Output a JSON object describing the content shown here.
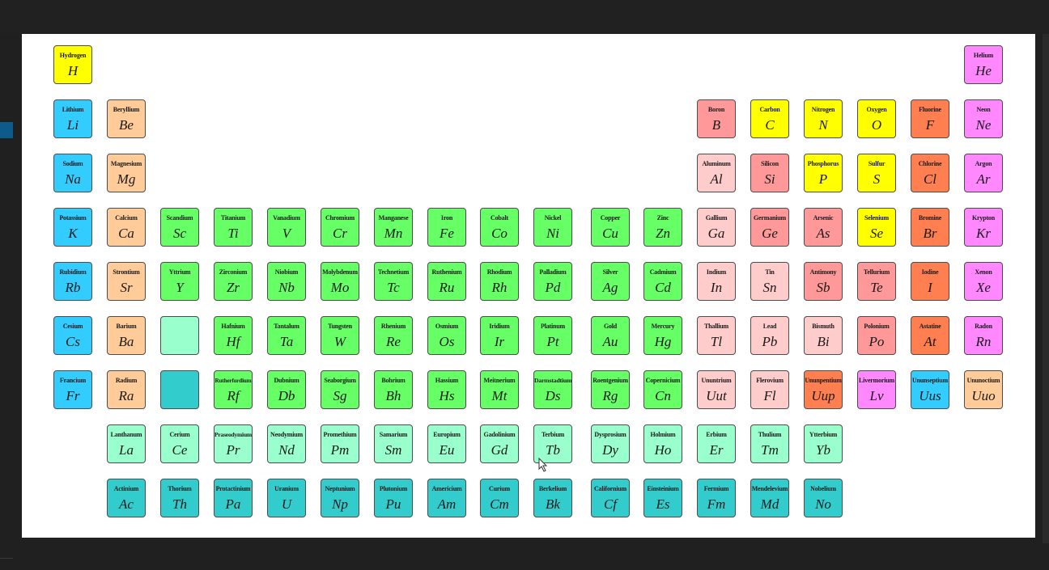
{
  "colors": {
    "alkali": "#33ccff",
    "alkaline_earth": "#ffcc99",
    "transition": "#66ff66",
    "post_transition": "#ffcccc",
    "metalloid": "#ff9999",
    "nonmetal": "#ffff00",
    "halogen": "#ff7f50",
    "noble_gas": "#ff88ff",
    "lanthanide": "#99ffcc",
    "actinide": "#33cccc",
    "page_background": "#202020",
    "panel_background": "#ffffff"
  },
  "elements": [
    {
      "name": "Hydrogen",
      "symbol": "H",
      "category": "nonmetal",
      "row": 1,
      "col": 1
    },
    {
      "name": "Helium",
      "symbol": "He",
      "category": "noble_gas",
      "row": 1,
      "col": 18
    },
    {
      "name": "Lithium",
      "symbol": "Li",
      "category": "alkali",
      "row": 2,
      "col": 1
    },
    {
      "name": "Beryllium",
      "symbol": "Be",
      "category": "alkaline_earth",
      "row": 2,
      "col": 2
    },
    {
      "name": "Boron",
      "symbol": "B",
      "category": "metalloid",
      "row": 2,
      "col": 13
    },
    {
      "name": "Carbon",
      "symbol": "C",
      "category": "nonmetal",
      "row": 2,
      "col": 14
    },
    {
      "name": "Nitrogen",
      "symbol": "N",
      "category": "nonmetal",
      "row": 2,
      "col": 15
    },
    {
      "name": "Oxygen",
      "symbol": "O",
      "category": "nonmetal",
      "row": 2,
      "col": 16
    },
    {
      "name": "Fluorine",
      "symbol": "F",
      "category": "halogen",
      "row": 2,
      "col": 17
    },
    {
      "name": "Neon",
      "symbol": "Ne",
      "category": "noble_gas",
      "row": 2,
      "col": 18
    },
    {
      "name": "Sodium",
      "symbol": "Na",
      "category": "alkali",
      "row": 3,
      "col": 1
    },
    {
      "name": "Magnesium",
      "symbol": "Mg",
      "category": "alkaline_earth",
      "row": 3,
      "col": 2
    },
    {
      "name": "Aluminum",
      "symbol": "Al",
      "category": "post_transition",
      "row": 3,
      "col": 13
    },
    {
      "name": "Silicon",
      "symbol": "Si",
      "category": "metalloid",
      "row": 3,
      "col": 14
    },
    {
      "name": "Phosphorus",
      "symbol": "P",
      "category": "nonmetal",
      "row": 3,
      "col": 15
    },
    {
      "name": "Sulfur",
      "symbol": "S",
      "category": "nonmetal",
      "row": 3,
      "col": 16
    },
    {
      "name": "Chlorine",
      "symbol": "Cl",
      "category": "halogen",
      "row": 3,
      "col": 17
    },
    {
      "name": "Argon",
      "symbol": "Ar",
      "category": "noble_gas",
      "row": 3,
      "col": 18
    },
    {
      "name": "Potassium",
      "symbol": "K",
      "category": "alkali",
      "row": 4,
      "col": 1
    },
    {
      "name": "Calcium",
      "symbol": "Ca",
      "category": "alkaline_earth",
      "row": 4,
      "col": 2
    },
    {
      "name": "Scandium",
      "symbol": "Sc",
      "category": "transition",
      "row": 4,
      "col": 3
    },
    {
      "name": "Titanium",
      "symbol": "Ti",
      "category": "transition",
      "row": 4,
      "col": 4
    },
    {
      "name": "Vanadium",
      "symbol": "V",
      "category": "transition",
      "row": 4,
      "col": 5
    },
    {
      "name": "Chromium",
      "symbol": "Cr",
      "category": "transition",
      "row": 4,
      "col": 6
    },
    {
      "name": "Manganese",
      "symbol": "Mn",
      "category": "transition",
      "row": 4,
      "col": 7
    },
    {
      "name": "Iron",
      "symbol": "Fe",
      "category": "transition",
      "row": 4,
      "col": 8
    },
    {
      "name": "Cobalt",
      "symbol": "Co",
      "category": "transition",
      "row": 4,
      "col": 9
    },
    {
      "name": "Nickel",
      "symbol": "Ni",
      "category": "transition",
      "row": 4,
      "col": 10
    },
    {
      "name": "Copper",
      "symbol": "Cu",
      "category": "transition",
      "row": 4,
      "col": 11
    },
    {
      "name": "Zinc",
      "symbol": "Zn",
      "category": "transition",
      "row": 4,
      "col": 12
    },
    {
      "name": "Gallium",
      "symbol": "Ga",
      "category": "post_transition",
      "row": 4,
      "col": 13
    },
    {
      "name": "Germanium",
      "symbol": "Ge",
      "category": "metalloid",
      "row": 4,
      "col": 14
    },
    {
      "name": "Arsenic",
      "symbol": "As",
      "category": "metalloid",
      "row": 4,
      "col": 15
    },
    {
      "name": "Selenium",
      "symbol": "Se",
      "category": "nonmetal",
      "row": 4,
      "col": 16
    },
    {
      "name": "Bromine",
      "symbol": "Br",
      "category": "halogen",
      "row": 4,
      "col": 17
    },
    {
      "name": "Krypton",
      "symbol": "Kr",
      "category": "noble_gas",
      "row": 4,
      "col": 18
    },
    {
      "name": "Rubidium",
      "symbol": "Rb",
      "category": "alkali",
      "row": 5,
      "col": 1
    },
    {
      "name": "Strontium",
      "symbol": "Sr",
      "category": "alkaline_earth",
      "row": 5,
      "col": 2
    },
    {
      "name": "Yttrium",
      "symbol": "Y",
      "category": "transition",
      "row": 5,
      "col": 3
    },
    {
      "name": "Zirconium",
      "symbol": "Zr",
      "category": "transition",
      "row": 5,
      "col": 4
    },
    {
      "name": "Niobium",
      "symbol": "Nb",
      "category": "transition",
      "row": 5,
      "col": 5
    },
    {
      "name": "Molybdenum",
      "symbol": "Mo",
      "category": "transition",
      "row": 5,
      "col": 6
    },
    {
      "name": "Technetium",
      "symbol": "Tc",
      "category": "transition",
      "row": 5,
      "col": 7
    },
    {
      "name": "Ruthenium",
      "symbol": "Ru",
      "category": "transition",
      "row": 5,
      "col": 8
    },
    {
      "name": "Rhodium",
      "symbol": "Rh",
      "category": "transition",
      "row": 5,
      "col": 9
    },
    {
      "name": "Palladium",
      "symbol": "Pd",
      "category": "transition",
      "row": 5,
      "col": 10
    },
    {
      "name": "Silver",
      "symbol": "Ag",
      "category": "transition",
      "row": 5,
      "col": 11
    },
    {
      "name": "Cadmium",
      "symbol": "Cd",
      "category": "transition",
      "row": 5,
      "col": 12
    },
    {
      "name": "Indium",
      "symbol": "In",
      "category": "post_transition",
      "row": 5,
      "col": 13
    },
    {
      "name": "Tin",
      "symbol": "Sn",
      "category": "post_transition",
      "row": 5,
      "col": 14
    },
    {
      "name": "Antimony",
      "symbol": "Sb",
      "category": "metalloid",
      "row": 5,
      "col": 15
    },
    {
      "name": "Tellurium",
      "symbol": "Te",
      "category": "metalloid",
      "row": 5,
      "col": 16
    },
    {
      "name": "Iodine",
      "symbol": "I",
      "category": "halogen",
      "row": 5,
      "col": 17
    },
    {
      "name": "Xenon",
      "symbol": "Xe",
      "category": "noble_gas",
      "row": 5,
      "col": 18
    },
    {
      "name": "Cesium",
      "symbol": "Cs",
      "category": "alkali",
      "row": 6,
      "col": 1
    },
    {
      "name": "Barium",
      "symbol": "Ba",
      "category": "alkaline_earth",
      "row": 6,
      "col": 2
    },
    {
      "name": "",
      "symbol": "",
      "category": "lanthanide",
      "row": 6,
      "col": 3
    },
    {
      "name": "Hafnium",
      "symbol": "Hf",
      "category": "transition",
      "row": 6,
      "col": 4
    },
    {
      "name": "Tantalum",
      "symbol": "Ta",
      "category": "transition",
      "row": 6,
      "col": 5
    },
    {
      "name": "Tungsten",
      "symbol": "W",
      "category": "transition",
      "row": 6,
      "col": 6
    },
    {
      "name": "Rhenium",
      "symbol": "Re",
      "category": "transition",
      "row": 6,
      "col": 7
    },
    {
      "name": "Osmium",
      "symbol": "Os",
      "category": "transition",
      "row": 6,
      "col": 8
    },
    {
      "name": "Iridium",
      "symbol": "Ir",
      "category": "transition",
      "row": 6,
      "col": 9
    },
    {
      "name": "Platinum",
      "symbol": "Pt",
      "category": "transition",
      "row": 6,
      "col": 10
    },
    {
      "name": "Gold",
      "symbol": "Au",
      "category": "transition",
      "row": 6,
      "col": 11
    },
    {
      "name": "Mercury",
      "symbol": "Hg",
      "category": "transition",
      "row": 6,
      "col": 12
    },
    {
      "name": "Thallium",
      "symbol": "Tl",
      "category": "post_transition",
      "row": 6,
      "col": 13
    },
    {
      "name": "Lead",
      "symbol": "Pb",
      "category": "post_transition",
      "row": 6,
      "col": 14
    },
    {
      "name": "Bismuth",
      "symbol": "Bi",
      "category": "post_transition",
      "row": 6,
      "col": 15
    },
    {
      "name": "Polonium",
      "symbol": "Po",
      "category": "metalloid",
      "row": 6,
      "col": 16
    },
    {
      "name": "Astatine",
      "symbol": "At",
      "category": "halogen",
      "row": 6,
      "col": 17
    },
    {
      "name": "Radon",
      "symbol": "Rn",
      "category": "noble_gas",
      "row": 6,
      "col": 18
    },
    {
      "name": "Francium",
      "symbol": "Fr",
      "category": "alkali",
      "row": 7,
      "col": 1
    },
    {
      "name": "Radium",
      "symbol": "Ra",
      "category": "alkaline_earth",
      "row": 7,
      "col": 2
    },
    {
      "name": "",
      "symbol": "",
      "category": "actinide",
      "row": 7,
      "col": 3
    },
    {
      "name": "Rutherfordium",
      "symbol": "Rf",
      "category": "transition",
      "row": 7,
      "col": 4
    },
    {
      "name": "Dubnium",
      "symbol": "Db",
      "category": "transition",
      "row": 7,
      "col": 5
    },
    {
      "name": "Seaborgium",
      "symbol": "Sg",
      "category": "transition",
      "row": 7,
      "col": 6
    },
    {
      "name": "Bohrium",
      "symbol": "Bh",
      "category": "transition",
      "row": 7,
      "col": 7
    },
    {
      "name": "Hassium",
      "symbol": "Hs",
      "category": "transition",
      "row": 7,
      "col": 8
    },
    {
      "name": "Meitnerium",
      "symbol": "Mt",
      "category": "transition",
      "row": 7,
      "col": 9
    },
    {
      "name": "Darmstadtium",
      "symbol": "Ds",
      "category": "transition",
      "row": 7,
      "col": 10
    },
    {
      "name": "Roentgenium",
      "symbol": "Rg",
      "category": "transition",
      "row": 7,
      "col": 11
    },
    {
      "name": "Copernicium",
      "symbol": "Cn",
      "category": "transition",
      "row": 7,
      "col": 12
    },
    {
      "name": "Ununtrium",
      "symbol": "Uut",
      "category": "post_transition",
      "row": 7,
      "col": 13
    },
    {
      "name": "Flerovium",
      "symbol": "Fl",
      "category": "post_transition",
      "row": 7,
      "col": 14
    },
    {
      "name": "Ununpentium",
      "symbol": "Uup",
      "category": "halogen",
      "row": 7,
      "col": 15
    },
    {
      "name": "Livermorium",
      "symbol": "Lv",
      "category": "noble_gas",
      "row": 7,
      "col": 16
    },
    {
      "name": "Ununseptium",
      "symbol": "Uus",
      "category": "alkali",
      "row": 7,
      "col": 17
    },
    {
      "name": "Ununoctium",
      "symbol": "Uuo",
      "category": "alkaline_earth",
      "row": 7,
      "col": 18
    },
    {
      "name": "Lanthanum",
      "symbol": "La",
      "category": "lanthanide",
      "row": 8,
      "col": 2
    },
    {
      "name": "Cerium",
      "symbol": "Ce",
      "category": "lanthanide",
      "row": 8,
      "col": 3
    },
    {
      "name": "Praseodymium",
      "symbol": "Pr",
      "category": "lanthanide",
      "row": 8,
      "col": 4
    },
    {
      "name": "Neodymium",
      "symbol": "Nd",
      "category": "lanthanide",
      "row": 8,
      "col": 5
    },
    {
      "name": "Promethium",
      "symbol": "Pm",
      "category": "lanthanide",
      "row": 8,
      "col": 6
    },
    {
      "name": "Samarium",
      "symbol": "Sm",
      "category": "lanthanide",
      "row": 8,
      "col": 7
    },
    {
      "name": "Europium",
      "symbol": "Eu",
      "category": "lanthanide",
      "row": 8,
      "col": 8
    },
    {
      "name": "Gadolinium",
      "symbol": "Gd",
      "category": "lanthanide",
      "row": 8,
      "col": 9
    },
    {
      "name": "Terbium",
      "symbol": "Tb",
      "category": "lanthanide",
      "row": 8,
      "col": 10
    },
    {
      "name": "Dysprosium",
      "symbol": "Dy",
      "category": "lanthanide",
      "row": 8,
      "col": 11
    },
    {
      "name": "Holmium",
      "symbol": "Ho",
      "category": "lanthanide",
      "row": 8,
      "col": 12
    },
    {
      "name": "Erbium",
      "symbol": "Er",
      "category": "lanthanide",
      "row": 8,
      "col": 13
    },
    {
      "name": "Thulium",
      "symbol": "Tm",
      "category": "lanthanide",
      "row": 8,
      "col": 14
    },
    {
      "name": "Ytterbium",
      "symbol": "Yb",
      "category": "lanthanide",
      "row": 8,
      "col": 15
    },
    {
      "name": "Actinium",
      "symbol": "Ac",
      "category": "actinide",
      "row": 9,
      "col": 2
    },
    {
      "name": "Thorium",
      "symbol": "Th",
      "category": "actinide",
      "row": 9,
      "col": 3
    },
    {
      "name": "Protactinium",
      "symbol": "Pa",
      "category": "actinide",
      "row": 9,
      "col": 4
    },
    {
      "name": "Uranium",
      "symbol": "U",
      "category": "actinide",
      "row": 9,
      "col": 5
    },
    {
      "name": "Neptunium",
      "symbol": "Np",
      "category": "actinide",
      "row": 9,
      "col": 6
    },
    {
      "name": "Plutonium",
      "symbol": "Pu",
      "category": "actinide",
      "row": 9,
      "col": 7
    },
    {
      "name": "Americium",
      "symbol": "Am",
      "category": "actinide",
      "row": 9,
      "col": 8
    },
    {
      "name": "Curium",
      "symbol": "Cm",
      "category": "actinide",
      "row": 9,
      "col": 9
    },
    {
      "name": "Berkelium",
      "symbol": "Bk",
      "category": "actinide",
      "row": 9,
      "col": 10
    },
    {
      "name": "Californium",
      "symbol": "Cf",
      "category": "actinide",
      "row": 9,
      "col": 11
    },
    {
      "name": "Einsteinium",
      "symbol": "Es",
      "category": "actinide",
      "row": 9,
      "col": 12
    },
    {
      "name": "Fermium",
      "symbol": "Fm",
      "category": "actinide",
      "row": 9,
      "col": 13
    },
    {
      "name": "Mendelevium",
      "symbol": "Md",
      "category": "actinide",
      "row": 9,
      "col": 14
    },
    {
      "name": "Nobelium",
      "symbol": "No",
      "category": "actinide",
      "row": 9,
      "col": 15
    }
  ]
}
